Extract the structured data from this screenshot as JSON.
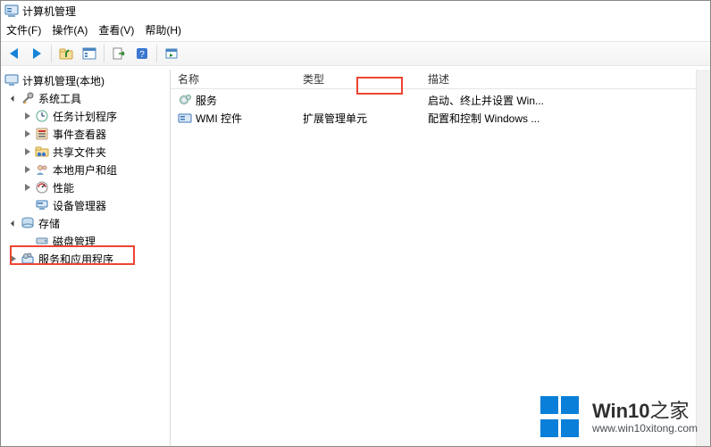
{
  "window": {
    "title": "计算机管理"
  },
  "menu": {
    "file": "文件(F)",
    "action": "操作(A)",
    "view": "查看(V)",
    "help": "帮助(H)"
  },
  "tree": {
    "root": "计算机管理(本地)",
    "system_tools": "系统工具",
    "task_scheduler": "任务计划程序",
    "event_viewer": "事件查看器",
    "shared_folders": "共享文件夹",
    "local_users": "本地用户和组",
    "performance": "性能",
    "device_manager": "设备管理器",
    "storage": "存储",
    "disk_management": "磁盘管理",
    "services_apps": "服务和应用程序"
  },
  "columns": {
    "name": "名称",
    "type": "类型",
    "desc": "描述"
  },
  "rows": [
    {
      "name": "服务",
      "type": "",
      "desc": "启动、终止并设置 Win..."
    },
    {
      "name": "WMI 控件",
      "type": "扩展管理单元",
      "desc": "配置和控制 Windows ..."
    }
  ],
  "watermark": {
    "line1a": "Win10",
    "line1b": "之家",
    "line2": "www.win10xitong.com"
  }
}
